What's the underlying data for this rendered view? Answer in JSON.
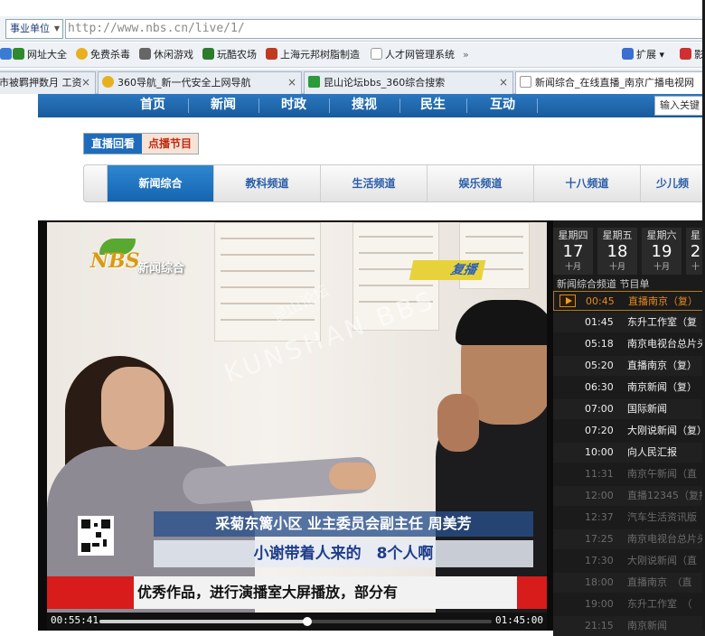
{
  "browser": {
    "site_select": "事业单位",
    "url": "http://www.nbs.cn/live/1/",
    "favorites": [
      "网址大全",
      "免费杀毒",
      "休闲游戏",
      "玩酷农场",
      "上海元邦树脂制造",
      "人才网管理系统"
    ],
    "more_label": "»",
    "extend_label": "扩展",
    "extra_label": "影",
    "tabs": [
      {
        "title": "市被羁押数月 工资"
      },
      {
        "title": "360导航_新一代安全上网导航"
      },
      {
        "title": "昆山论坛bbs_360综合搜索"
      },
      {
        "title": "新闻综合_在线直播_南京广播电视网"
      }
    ]
  },
  "site": {
    "nav": [
      "首页",
      "新闻",
      "时政",
      "搜视",
      "民生",
      "互动"
    ],
    "search_placeholder": "输入关键",
    "mode_tabs": [
      "直播回看",
      "点播节目"
    ],
    "channels": [
      "新闻综合",
      "教科频道",
      "生活频道",
      "娱乐频道",
      "十八频道",
      "少儿频"
    ]
  },
  "video": {
    "logo": "NBS",
    "logo_sub": "新闻综合",
    "replay_label": "复播",
    "watermark_bbs": "昆山论坛",
    "watermark": "KUNSHAN BBS",
    "caption_name": "采菊东篱小区 业主委员会副主任 周美芳",
    "caption_quote": "小谢带着人来的　8个人啊",
    "ticker": "优秀作品，进行演播室大屏播放，部分有",
    "time_current": "00:55:41",
    "time_total": "01:45:00",
    "progress": 0.53
  },
  "schedule": {
    "days": [
      {
        "weekday": "星期四",
        "date": "17",
        "month": "十月"
      },
      {
        "weekday": "星期五",
        "date": "18",
        "month": "十月"
      },
      {
        "weekday": "星期六",
        "date": "19",
        "month": "十月"
      },
      {
        "weekday": "星",
        "date": "2",
        "month": "十"
      }
    ],
    "title": "新闻综合频道 节目单",
    "items": [
      {
        "time": "00:45",
        "name": "直播南京（复）",
        "state": "current"
      },
      {
        "time": "01:45",
        "name": "东升工作室（复",
        "state": "past"
      },
      {
        "time": "05:18",
        "name": "南京电视台总片头",
        "state": "past"
      },
      {
        "time": "05:20",
        "name": "直播南京（复）",
        "state": "past"
      },
      {
        "time": "06:30",
        "name": "南京新闻（复）",
        "state": "past"
      },
      {
        "time": "07:00",
        "name": "国际新闻",
        "state": "past"
      },
      {
        "time": "07:20",
        "name": "大刚说新闻（复）",
        "state": "past"
      },
      {
        "time": "10:00",
        "name": "向人民汇报",
        "state": "past"
      },
      {
        "time": "11:31",
        "name": "南京午新闻（直",
        "state": "future"
      },
      {
        "time": "12:00",
        "name": "直播12345（复播",
        "state": "future"
      },
      {
        "time": "12:37",
        "name": "汽车生活资讯版",
        "state": "future"
      },
      {
        "time": "17:25",
        "name": "南京电视台总片头",
        "state": "future"
      },
      {
        "time": "17:30",
        "name": "大刚说新闻（直",
        "state": "future"
      },
      {
        "time": "18:00",
        "name": "直播南京　（直",
        "state": "future"
      },
      {
        "time": "19:00",
        "name": "东升工作室　（",
        "state": "future"
      },
      {
        "time": "21:15",
        "name": "南京新闻",
        "state": "future"
      }
    ]
  }
}
